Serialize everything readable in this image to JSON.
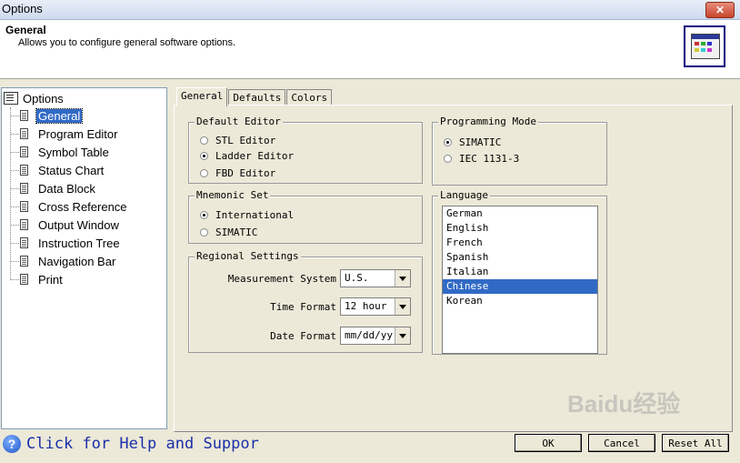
{
  "window": {
    "title": "Options",
    "close_label": "✕"
  },
  "header": {
    "title": "General",
    "subtitle": "Allows you to configure general software options."
  },
  "tree": {
    "root": "Options",
    "items": [
      {
        "label": "General",
        "selected": true
      },
      {
        "label": "Program Editor"
      },
      {
        "label": "Symbol Table"
      },
      {
        "label": "Status Chart"
      },
      {
        "label": "Data Block"
      },
      {
        "label": "Cross Reference"
      },
      {
        "label": "Output Window"
      },
      {
        "label": "Instruction Tree"
      },
      {
        "label": "Navigation Bar"
      },
      {
        "label": "Print"
      }
    ]
  },
  "tabs": [
    {
      "label": "General",
      "active": true
    },
    {
      "label": "Defaults"
    },
    {
      "label": "Colors"
    }
  ],
  "default_editor": {
    "label": "Default Editor",
    "options": [
      {
        "label": "STL Editor",
        "selected": false
      },
      {
        "label": "Ladder Editor",
        "selected": true
      },
      {
        "label": "FBD Editor",
        "selected": false
      }
    ]
  },
  "mnemonic_set": {
    "label": "Mnemonic Set",
    "options": [
      {
        "label": "International",
        "selected": true
      },
      {
        "label": "SIMATIC",
        "selected": false
      }
    ]
  },
  "regional_settings": {
    "label": "Regional Settings",
    "measurement_label": "Measurement System",
    "measurement_value": "U.S.",
    "time_label": "Time Format",
    "time_value": "12 hour",
    "date_label": "Date Format",
    "date_value": "mm/dd/yy"
  },
  "programming_mode": {
    "label": "Programming Mode",
    "options": [
      {
        "label": "SIMATIC",
        "selected": true
      },
      {
        "label": "IEC 1131-3",
        "selected": false
      }
    ]
  },
  "language": {
    "label": "Language",
    "items": [
      "German",
      "English",
      "French",
      "Spanish",
      "Italian",
      "Chinese",
      "Korean"
    ],
    "selected": "Chinese"
  },
  "help_text": "Click for Help and Suppor",
  "buttons": {
    "ok": "OK",
    "cancel": "Cancel",
    "reset": "Reset All"
  },
  "watermark": "Baidu经验"
}
